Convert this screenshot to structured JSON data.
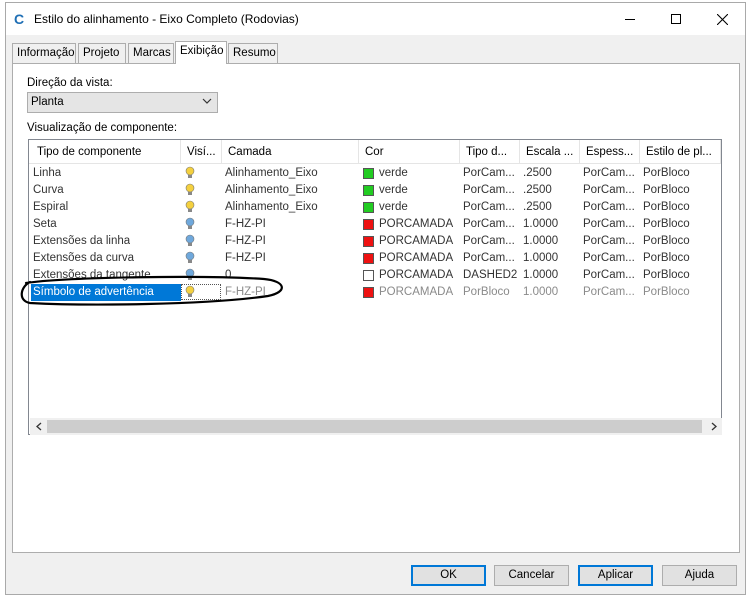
{
  "window": {
    "title": "Estilo do alinhamento - Eixo Completo (Rodovias)",
    "app_icon": "C"
  },
  "tabs": [
    {
      "label": "Informação"
    },
    {
      "label": "Projeto"
    },
    {
      "label": "Marcas"
    },
    {
      "label": "Exibição",
      "active": true
    },
    {
      "label": "Resumo"
    }
  ],
  "view_direction": {
    "label": "Direção da vista:",
    "value": "Planta"
  },
  "component_display": {
    "label": "Visualização de componente:",
    "columns": [
      "Tipo de componente",
      "Visí...",
      "Camada",
      "Cor",
      "Tipo d...",
      "Escala ...",
      "Espess...",
      "Estilo de pl..."
    ],
    "rows": [
      {
        "name": "Linha",
        "visible": "on",
        "layer": "Alinhamento_Eixo",
        "color_name": "verde",
        "color_hex": "#22cc22",
        "linetype": "PorCam...",
        "scale": ".2500",
        "weight": "PorCam...",
        "plot_style": "PorBloco"
      },
      {
        "name": "Curva",
        "visible": "on",
        "layer": "Alinhamento_Eixo",
        "color_name": "verde",
        "color_hex": "#22cc22",
        "linetype": "PorCam...",
        "scale": ".2500",
        "weight": "PorCam...",
        "plot_style": "PorBloco"
      },
      {
        "name": "Espiral",
        "visible": "on",
        "layer": "Alinhamento_Eixo",
        "color_name": "verde",
        "color_hex": "#22cc22",
        "linetype": "PorCam...",
        "scale": ".2500",
        "weight": "PorCam...",
        "plot_style": "PorBloco"
      },
      {
        "name": "Seta",
        "visible": "off",
        "layer": "F-HZ-PI",
        "color_name": "PORCAMADA",
        "color_hex": "#ee1111",
        "linetype": "PorCam...",
        "scale": "1.0000",
        "weight": "PorCam...",
        "plot_style": "PorBloco"
      },
      {
        "name": "Extensões da linha",
        "visible": "off",
        "layer": "F-HZ-PI",
        "color_name": "PORCAMADA",
        "color_hex": "#ee1111",
        "linetype": "PorCam...",
        "scale": "1.0000",
        "weight": "PorCam...",
        "plot_style": "PorBloco"
      },
      {
        "name": "Extensões da curva",
        "visible": "off",
        "layer": "F-HZ-PI",
        "color_name": "PORCAMADA",
        "color_hex": "#ee1111",
        "linetype": "PorCam...",
        "scale": "1.0000",
        "weight": "PorCam...",
        "plot_style": "PorBloco"
      },
      {
        "name": "Extensões da tangente",
        "visible": "off",
        "layer": "0",
        "color_name": "PORCAMADA",
        "color_hex": "#ffffff",
        "linetype": "DASHED2",
        "scale": "1.0000",
        "weight": "PorCam...",
        "plot_style": "PorBloco"
      },
      {
        "name": "Símbolo de advertência",
        "visible": "on",
        "layer": "F-HZ-PI",
        "color_name": "PORCAMADA",
        "color_hex": "#ee1111",
        "linetype": "PorBloco",
        "scale": "1.0000",
        "weight": "PorCam...",
        "plot_style": "PorBloco",
        "selected": true
      }
    ]
  },
  "buttons": {
    "ok": "OK",
    "cancel": "Cancelar",
    "apply": "Aplicar",
    "help": "Ajuda"
  },
  "colors": {
    "accent": "#0078d7",
    "bulb_on": "#f4d03f",
    "bulb_off": "#6fa8dc",
    "annotation": "#000000"
  }
}
